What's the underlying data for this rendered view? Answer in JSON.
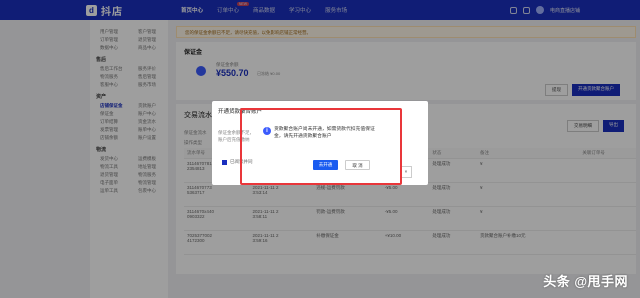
{
  "header": {
    "logo_text": "抖店",
    "logo_mark": "d",
    "nav": [
      {
        "label": "首页中心"
      },
      {
        "label": "订单中心",
        "badge": "NEW"
      },
      {
        "label": "商品数据"
      },
      {
        "label": "学习中心"
      },
      {
        "label": "服务市场"
      }
    ],
    "user_label": "电商直播店铺"
  },
  "notice": "您的保证金余额已不足，请尽快充值，以免影响店铺正常经营。",
  "deposit": {
    "title": "保证金",
    "label": "保证金余额",
    "amount": "¥550.70",
    "tag": "已冻结 ¥0.00",
    "btn_withdraw": "提现",
    "btn_open": "开通货款聚合账户"
  },
  "transactions": {
    "title": "交易流水",
    "filters": [
      "保证金流水",
      "操作类型",
      "时间"
    ],
    "col_headers": [
      "流水单号",
      "交易时间",
      "动账类型",
      "动账金额",
      "状态",
      "备注",
      "",
      "关联订单号"
    ],
    "rows": [
      {
        "id": "3114670781\n2354813",
        "time": "2021-11-11 2\n3:59:14",
        "type": "罚款-运费罚款",
        "amount": "-¥5.00",
        "status": "处理成功",
        "note": "¥"
      },
      {
        "id": "3114670773\n5363717",
        "time": "2021-11-11 2\n3:53:14",
        "type": "违规-运费罚款",
        "amount": "-¥5.00",
        "status": "处理成功",
        "note": "¥"
      },
      {
        "id": "3114670x440\n0903322",
        "time": "2021-11-11 2\n3:58:11",
        "type": "罚款-运费罚款",
        "amount": "-¥5.00",
        "status": "处理成功",
        "note": "¥"
      },
      {
        "id": "7025377002\n4172300",
        "time": "2021-11-11 2\n3:59:16",
        "type": "补缴保证金",
        "amount": "+¥10.00",
        "status": "处理成功",
        "note": "货款聚合账户补缴10元"
      }
    ],
    "export_label": "导出",
    "action_label": "交易明细"
  },
  "sidebar": {
    "groups": [
      {
        "title": "",
        "rows": [
          [
            "用户管理",
            "客户管理"
          ],
          [
            "订单管理",
            "退货管理"
          ],
          [
            "数据中心",
            "商品中心"
          ]
        ]
      },
      {
        "title": "售后",
        "rows": [
          [
            "售后工作台",
            "服务评价"
          ],
          [
            "物流服务",
            "售后管理"
          ],
          [
            "客服中心",
            "服务市场"
          ]
        ]
      },
      {
        "title": "资产",
        "rows": [
          [
            "店铺保证金",
            "货款账户"
          ],
          [
            "保证金",
            "账户中心"
          ],
          [
            "订单结算",
            "资金流水"
          ],
          [
            "发票管理",
            "账单中心"
          ],
          [
            "店铺余额",
            "账户设置"
          ]
        ]
      },
      {
        "title": "物流",
        "rows": [
          [
            "发货中心",
            "运费模板"
          ],
          [
            "物流工具",
            "地址管理"
          ],
          [
            "退货管理",
            "物流服务"
          ],
          [
            "电子面单",
            "物流管理"
          ],
          [
            "运单工具",
            "包裹中心"
          ]
        ]
      }
    ]
  },
  "background_dialog": {
    "title": "开通货款聚合账户",
    "text": "保证金余额不足，请开通货款聚合账户后充值缴纳",
    "checkbox_label": "已阅读并同意",
    "close_label": "×"
  },
  "dialog": {
    "message": "货款聚合账户尚未开通，如需货款代扣充值保证金，请先开通货款聚合账户",
    "info_icon": "i",
    "confirm_label": "去开通",
    "cancel_label": "取 消"
  },
  "watermark": "头条 @甩手网",
  "colors": {
    "brand": "#1a2fbf",
    "primary_button": "#1a5cf0",
    "highlight": "#e9363a",
    "info_icon": "#3b5bfd"
  }
}
